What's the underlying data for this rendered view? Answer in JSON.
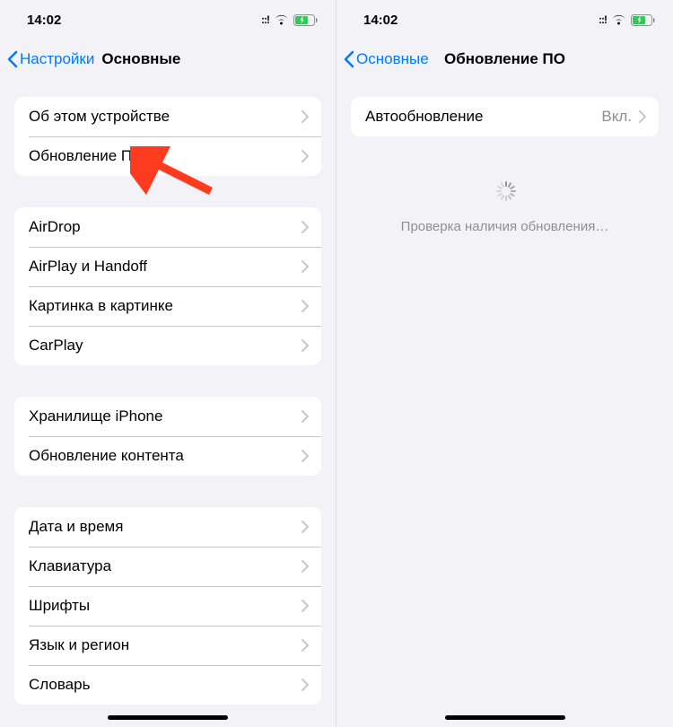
{
  "status": {
    "time": "14:02",
    "dual_sim": "::!"
  },
  "left": {
    "back_label": "Настройки",
    "title": "Основные",
    "groups": [
      [
        {
          "label": "Об этом устройстве"
        },
        {
          "label": "Обновление ПО",
          "highlighted": true
        }
      ],
      [
        {
          "label": "AirDrop"
        },
        {
          "label": "AirPlay и Handoff"
        },
        {
          "label": "Картинка в картинке"
        },
        {
          "label": "CarPlay"
        }
      ],
      [
        {
          "label": "Хранилище iPhone"
        },
        {
          "label": "Обновление контента"
        }
      ],
      [
        {
          "label": "Дата и время"
        },
        {
          "label": "Клавиатура"
        },
        {
          "label": "Шрифты"
        },
        {
          "label": "Язык и регион"
        },
        {
          "label": "Словарь"
        }
      ]
    ]
  },
  "right": {
    "back_label": "Основные",
    "title": "Обновление ПО",
    "auto_update_label": "Автообновление",
    "auto_update_value": "Вкл.",
    "checking_text": "Проверка наличия обновления…"
  },
  "colors": {
    "link": "#007aff",
    "bg": "#f2f2f7",
    "card": "#ffffff",
    "secondary": "#8e8e93",
    "arrow": "#ff3b1f"
  }
}
